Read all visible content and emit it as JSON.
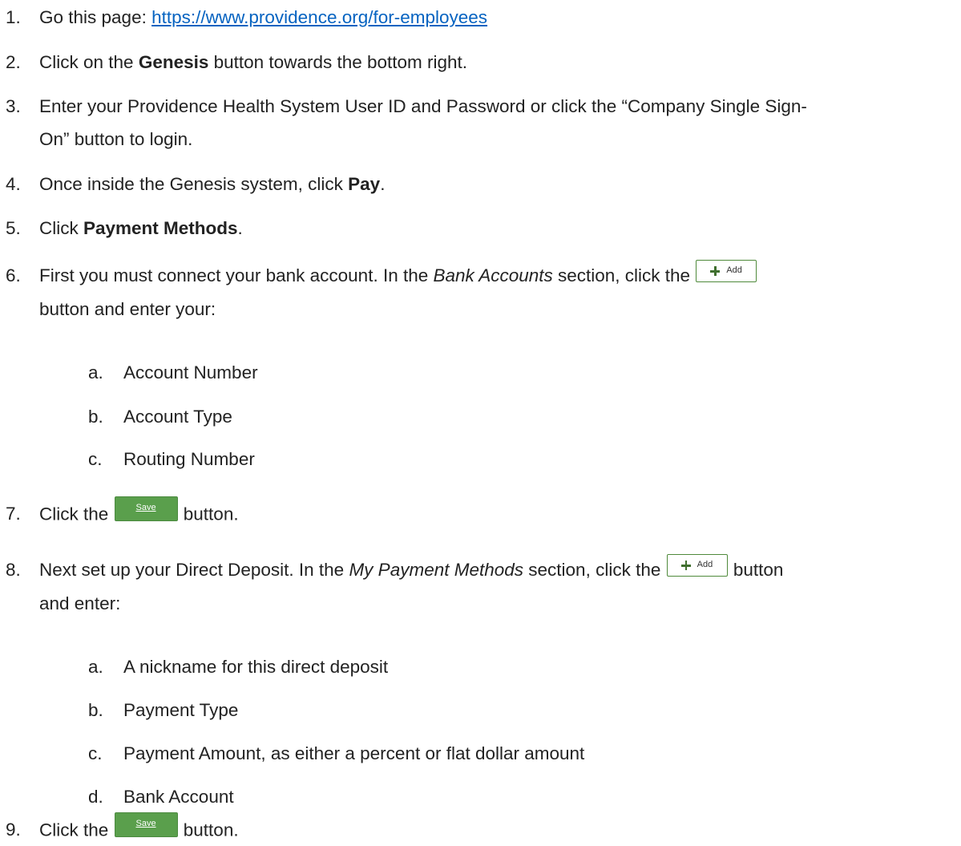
{
  "steps": [
    {
      "num": "1.",
      "prefix": "Go this page: ",
      "link": "https://www.providence.org/for-employees"
    },
    {
      "num": "2.",
      "prefix": "Click on the ",
      "bold": "Genesis",
      "suffix": " button towards the bottom right."
    },
    {
      "num": "3.",
      "line1": "Enter your Providence Health System User ID and Password or click the “Company Single Sign-",
      "line2": "On” button to login."
    },
    {
      "num": "4.",
      "prefix": "Once inside the Genesis system, click ",
      "bold": "Pay",
      "suffix": "."
    },
    {
      "num": "5.",
      "prefix": "Click ",
      "bold": "Payment Methods",
      "suffix": "."
    },
    {
      "num": "6.",
      "prefix": "First you must connect your bank account. In the ",
      "italic": "Bank Accounts",
      "mid": " section, click the ",
      "line2": "button and enter your:",
      "subitems": [
        {
          "letter": "a.",
          "text": "Account Number"
        },
        {
          "letter": "b.",
          "text": "Account Type"
        },
        {
          "letter": "c.",
          "text": "Routing Number"
        }
      ]
    },
    {
      "num": "7.",
      "prefix": "Click the ",
      "suffix": " button."
    },
    {
      "num": "8.",
      "prefix": "Next set up your Direct Deposit. In the ",
      "italic": "My Payment Methods",
      "mid": " section, click the ",
      "suffix": " button",
      "line2": "and enter:",
      "subitems": [
        {
          "letter": "a.",
          "text": "A nickname for this direct deposit"
        },
        {
          "letter": "b.",
          "text": "Payment Type"
        },
        {
          "letter": "c.",
          "text": "Payment Amount, as either a percent or flat dollar amount"
        },
        {
          "letter": "d.",
          "text": "Bank Account"
        }
      ]
    },
    {
      "num": "9.",
      "prefix": "Click the ",
      "suffix": " button."
    }
  ],
  "buttons": {
    "add_label": "Add",
    "save_label": "Save",
    "add_icon": "plus-icon",
    "add_border_color": "#4f8a3b",
    "save_bg_color": "#5a9f4c"
  },
  "colors": {
    "text": "#222222",
    "link": "#0563c1"
  }
}
